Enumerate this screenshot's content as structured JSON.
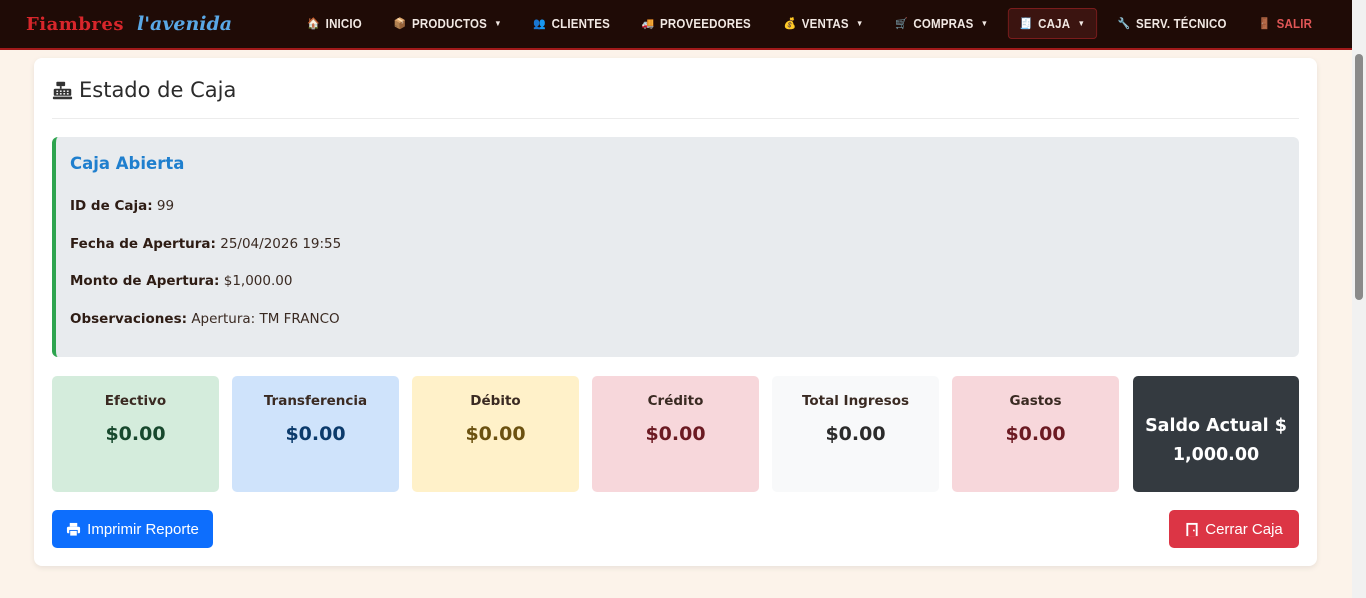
{
  "brand": {
    "part1": "Fiambres",
    "part2": "l'avenida"
  },
  "nav": [
    {
      "icon": "home-icon",
      "glyph": "🏠",
      "label": "INICIO",
      "dropdown": false
    },
    {
      "icon": "box-icon",
      "glyph": "📦",
      "label": "PRODUCTOS",
      "dropdown": true
    },
    {
      "icon": "users-icon",
      "glyph": "👥",
      "label": "CLIENTES",
      "dropdown": false
    },
    {
      "icon": "truck-icon",
      "glyph": "🚚",
      "label": "PROVEEDORES",
      "dropdown": false
    },
    {
      "icon": "money-bag-icon",
      "glyph": "💰",
      "label": "VENTAS",
      "dropdown": true
    },
    {
      "icon": "cart-icon",
      "glyph": "🛒",
      "label": "COMPRAS",
      "dropdown": true
    },
    {
      "icon": "register-icon",
      "glyph": "🧾",
      "label": "CAJA",
      "dropdown": true,
      "active": true
    },
    {
      "icon": "wrench-icon",
      "glyph": "🔧",
      "label": "SERV. TÉCNICO",
      "dropdown": false
    },
    {
      "icon": "door-icon",
      "glyph": "🚪",
      "label": "SALIR",
      "dropdown": false
    }
  ],
  "page": {
    "title": "Estado de Caja"
  },
  "info": {
    "title": "Caja Abierta",
    "id_label": "ID de Caja:",
    "id_value": "99",
    "fecha_label": "Fecha de Apertura:",
    "fecha_value": "25/04/2026 19:55",
    "monto_label": "Monto de Apertura:",
    "monto_value": "$1,000.00",
    "obs_label": "Observaciones:",
    "obs_value": "Apertura: TM FRANCO"
  },
  "stats": [
    {
      "label": "Efectivo",
      "value": "$0.00",
      "bg": "#d4ecdc",
      "color": "#17482d"
    },
    {
      "label": "Transferencia",
      "value": "$0.00",
      "bg": "#cfe3fb",
      "color": "#0b3a6b"
    },
    {
      "label": "Débito",
      "value": "$0.00",
      "bg": "#fff1c9",
      "color": "#6b5110"
    },
    {
      "label": "Crédito",
      "value": "$0.00",
      "bg": "#f7d7db",
      "color": "#6b1a22"
    },
    {
      "label": "Total Ingresos",
      "value": "$0.00",
      "bg": "#f8f9fa",
      "color": "#2b2b2b"
    },
    {
      "label": "Gastos",
      "value": "$0.00",
      "bg": "#f7d7db",
      "color": "#6b1a22"
    }
  ],
  "saldo": {
    "line1": "Saldo Actual $",
    "line2": "1,000.00"
  },
  "buttons": {
    "print": "Imprimir Reporte",
    "close": "Cerrar Caja"
  }
}
